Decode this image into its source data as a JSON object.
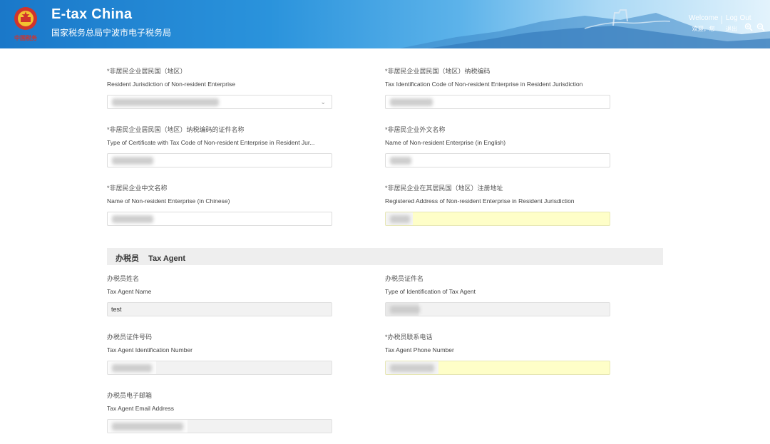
{
  "header": {
    "title": "E-tax China",
    "subtitle": "国家税务总局宁波市电子税务局",
    "welcome_en": "Welcome",
    "welcome_cn": "欢迎，您",
    "logout_en": "Log Out",
    "logout_cn": "退出",
    "emblem_text": "中国税务"
  },
  "form": {
    "resident_jurisdiction": {
      "label_cn": "*非居民企业居民国（地区）",
      "label_en": "Resident Jurisdiction of Non-resident Enterprise",
      "value": ""
    },
    "tax_id_code": {
      "label_cn": "*非居民企业居民国（地区）纳税编码",
      "label_en": "Tax Identification Code of Non-resident Enterprise in Resident Jurisdiction",
      "value": ""
    },
    "cert_type": {
      "label_cn": "*非居民企业居民国（地区）纳税编码的证件名称",
      "label_en": "Type of Certificate with Tax Code of Non-resident Enterprise in Resident Jur...",
      "value": ""
    },
    "name_english": {
      "label_cn": "*非居民企业外文名称",
      "label_en": "Name of Non-resident Enterprise (in English)",
      "value": ""
    },
    "name_chinese": {
      "label_cn": "*非居民企业中文名称",
      "label_en": "Name of Non-resident Enterprise (in Chinese)",
      "value": ""
    },
    "registered_address": {
      "label_cn": "*非居民企业在其居民国（地区）注册地址",
      "label_en": "Registered Address of Non-resident Enterprise in Resident Jurisdiction",
      "value": ""
    }
  },
  "tax_agent": {
    "section_cn": "办税员",
    "section_en": "Tax Agent",
    "name": {
      "label_cn": "办税员姓名",
      "label_en": "Tax Agent Name",
      "value": "test"
    },
    "id_type": {
      "label_cn": "办税员证件名",
      "label_en": "Type of Identification of Tax Agent",
      "value": ""
    },
    "id_number": {
      "label_cn": "办税员证件号码",
      "label_en": "Tax Agent Identification Number",
      "value": ""
    },
    "phone": {
      "label_cn": "*办税员联系电话",
      "label_en": "Tax Agent Phone Number",
      "value": ""
    },
    "email": {
      "label_cn": "办税员电子邮箱",
      "label_en": "Tax Agent Email Address",
      "value": ""
    }
  },
  "colors": {
    "header_blue": "#1a78c9",
    "highlight_yellow": "#fefec8",
    "readonly_grey": "#f2f2f2"
  },
  "icons": [
    "national-emblem-icon",
    "zoom-in-icon",
    "zoom-out-icon",
    "chevron-down-icon"
  ]
}
